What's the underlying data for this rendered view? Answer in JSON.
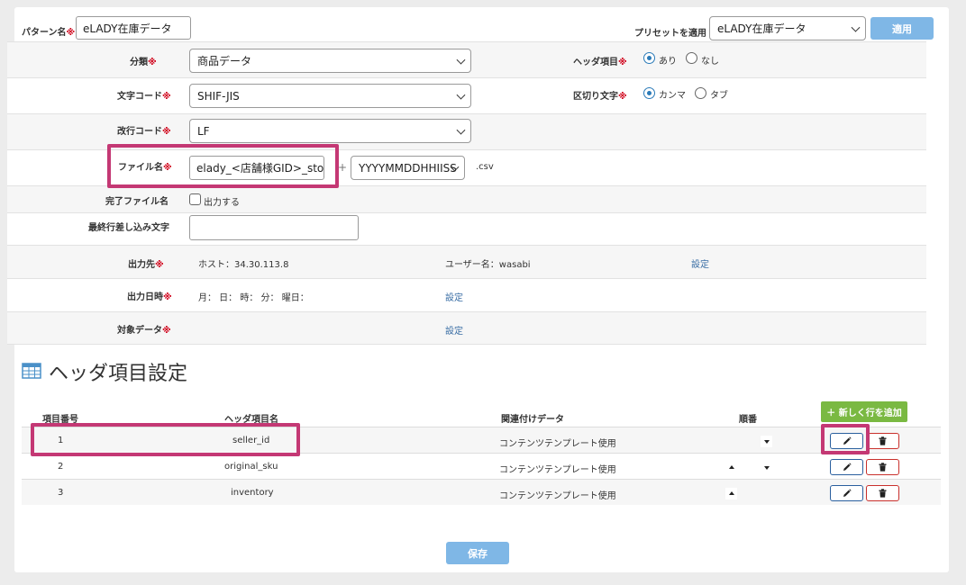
{
  "pattern": {
    "label": "パターン名",
    "value": "eLADY在庫データ"
  },
  "preset": {
    "label": "プリセットを適用",
    "selected": "eLADY在庫データ",
    "apply_label": "適用"
  },
  "required_mark": "※",
  "form": {
    "category": {
      "label": "分類",
      "selected": "商品データ"
    },
    "header_item": {
      "label": "ヘッダ項目",
      "options": [
        "あり",
        "なし"
      ],
      "selected": "あり"
    },
    "encoding": {
      "label": "文字コード",
      "selected": "SHIF-JIS"
    },
    "delimiter": {
      "label": "区切り文字",
      "options": [
        "カンマ",
        "タブ"
      ],
      "selected": "カンマ"
    },
    "newline": {
      "label": "改行コード",
      "selected": "LF"
    },
    "filename": {
      "label": "ファイル名",
      "value": "elady_<店舗様GID>_stock",
      "plus": "+",
      "date_format": "YYYYMMDDHHIISS",
      "extension": ".csv"
    },
    "complete_file": {
      "label": "完了ファイル名",
      "checkbox_label": "出力する",
      "checked": false
    },
    "last_line": {
      "label": "最終行差し込み文字",
      "value": ""
    },
    "destination": {
      "label": "出力先",
      "host": "ホスト：34.30.113.8",
      "user": "ユーザー名：wasabi",
      "setting": "設定"
    },
    "output_datetime": {
      "label": "出力日時",
      "value": "月： 日： 時： 分： 曜日：",
      "setting": "設定"
    },
    "target_data": {
      "label": "対象データ",
      "setting": "設定"
    }
  },
  "header_section": {
    "title": "ヘッダ項目設定",
    "add_row_label": "＋ 新しく行を追加",
    "columns": [
      "項目番号",
      "ヘッダ項目名",
      "関連付けデータ",
      "順番"
    ],
    "rows": [
      {
        "no": "1",
        "name": "seller_id",
        "data": "コンテンツテンプレート使用",
        "can_up": false,
        "can_down": true
      },
      {
        "no": "2",
        "name": "original_sku",
        "data": "コンテンツテンプレート使用",
        "can_up": true,
        "can_down": true
      },
      {
        "no": "3",
        "name": "inventory",
        "data": "コンテンツテンプレート使用",
        "can_up": true,
        "can_down": false
      }
    ]
  },
  "save_label": "保存",
  "colors": {
    "highlight": "#c43874",
    "link": "#3a6ea5",
    "primary_button": "#7fb7e6",
    "add_button": "#7ab942",
    "required": "#d0021b"
  },
  "icons": [
    "table-icon",
    "pencil-icon",
    "trash-icon",
    "caret-up-icon",
    "caret-down-icon",
    "chevron-down-icon"
  ]
}
